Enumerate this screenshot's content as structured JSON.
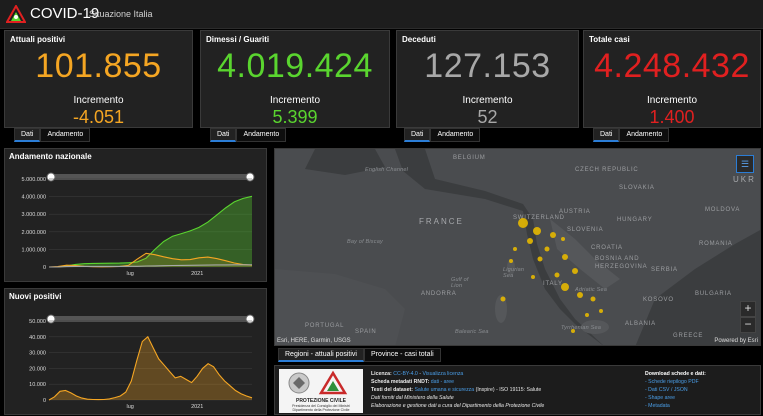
{
  "header": {
    "title": "COVID-19",
    "subtitle": "Situazione Italia"
  },
  "stats": [
    {
      "label": "Attuali positivi",
      "value": "101.855",
      "increment_label": "Incremento",
      "increment": "-4.051",
      "color": "#f5a623",
      "tabs": [
        "Dati",
        "Andamento"
      ]
    },
    {
      "label": "Dimessi / Guariti",
      "value": "4.019.424",
      "increment_label": "Incremento",
      "increment": "5.399",
      "color": "#5ad52f",
      "tabs": [
        "Dati",
        "Andamento"
      ]
    },
    {
      "label": "Deceduti",
      "value": "127.153",
      "increment_label": "Incremento",
      "increment": "52",
      "color": "#a8a8a8",
      "tabs": [
        "Dati",
        "Andamento"
      ]
    },
    {
      "label": "Totale casi",
      "value": "4.248.432",
      "increment_label": "Incremento",
      "increment": "1.400",
      "color": "#e02020",
      "tabs": [
        "Dati",
        "Andamento"
      ]
    }
  ],
  "chart_data": [
    {
      "type": "area",
      "title": "Andamento nazionale",
      "ylim": [
        0,
        5000000
      ],
      "yticks": [
        "5.000.000",
        "4.000.000",
        "3.000.000",
        "2.000.000",
        "1.000.000",
        "0"
      ],
      "xticks": [
        "lug",
        "2021"
      ],
      "series": [
        {
          "color": "#5ad52f",
          "values": [
            0,
            3000,
            60000,
            150000,
            190000,
            205000,
            210000,
            215000,
            222000,
            240000,
            290000,
            500000,
            1000000,
            1450000,
            1750000,
            1900000,
            2050000,
            2250000,
            2550000,
            2950000,
            3350000,
            3700000,
            3900000,
            4019424
          ]
        },
        {
          "color": "#f5a623",
          "values": [
            0,
            20000,
            100000,
            80000,
            40000,
            15000,
            12000,
            15000,
            35000,
            90000,
            450000,
            780000,
            700000,
            580000,
            470000,
            410000,
            420000,
            520000,
            560000,
            480000,
            360000,
            230000,
            140000,
            101855
          ]
        },
        {
          "color": "#a8a8a8",
          "values": [
            0,
            2000,
            25000,
            33000,
            34500,
            35000,
            35200,
            35500,
            35900,
            37000,
            42000,
            55000,
            65000,
            75000,
            85000,
            92000,
            97000,
            102000,
            110000,
            117000,
            122000,
            125000,
            126500,
            127153
          ]
        }
      ]
    },
    {
      "type": "area",
      "title": "Nuovi positivi",
      "ylim": [
        0,
        50000
      ],
      "yticks": [
        "50.000",
        "40.000",
        "30.000",
        "20.000",
        "10.000",
        "0"
      ],
      "xticks": [
        "lug",
        "2021"
      ],
      "series": [
        {
          "color": "#f5a623",
          "values": [
            0,
            2000,
            5500,
            6000,
            4500,
            2500,
            1200,
            500,
            300,
            250,
            300,
            700,
            1500,
            2500,
            5000,
            12000,
            25000,
            37000,
            40000,
            33000,
            26000,
            22000,
            18000,
            14000,
            15000,
            13000,
            11000,
            15000,
            20000,
            23000,
            21000,
            16000,
            12000,
            9000,
            6000,
            4000,
            2500,
            1400
          ]
        }
      ]
    }
  ],
  "map": {
    "labels": [
      {
        "text": "English Channel",
        "kind": "sea"
      },
      {
        "text": "BELGIUM",
        "kind": "small"
      },
      {
        "text": "CZECH REPUBLIC",
        "kind": "small"
      },
      {
        "text": "SLOVAKIA",
        "kind": "small"
      },
      {
        "text": "FRANCE",
        "kind": "big"
      },
      {
        "text": "AUSTRIA",
        "kind": "small"
      },
      {
        "text": "HUNGARY",
        "kind": "small"
      },
      {
        "text": "SWITZERLAND",
        "kind": "small"
      },
      {
        "text": "SLOVENIA",
        "kind": "small"
      },
      {
        "text": "CROATIA",
        "kind": "small"
      },
      {
        "text": "MOLDOVA",
        "kind": "small"
      },
      {
        "text": "ROMANIA",
        "kind": "small"
      },
      {
        "text": "Bay of Biscay",
        "kind": "sea"
      },
      {
        "text": "BOSNIA AND HERZEGOVINA",
        "kind": "small"
      },
      {
        "text": "SERBIA",
        "kind": "small"
      },
      {
        "text": "ITALY",
        "kind": "small"
      },
      {
        "text": "Ligurian Sea",
        "kind": "sea"
      },
      {
        "text": "Gulf of Lion",
        "kind": "sea"
      },
      {
        "text": "ANDORRA",
        "kind": "small"
      },
      {
        "text": "Adriatic Sea",
        "kind": "sea"
      },
      {
        "text": "BULGARIA",
        "kind": "small"
      },
      {
        "text": "KOSOVO",
        "kind": "small"
      },
      {
        "text": "PORTUGAL",
        "kind": "small"
      },
      {
        "text": "SPAIN",
        "kind": "small"
      },
      {
        "text": "ALBANIA",
        "kind": "small"
      },
      {
        "text": "Tyrrhenian Sea",
        "kind": "sea"
      },
      {
        "text": "Balearic Sea",
        "kind": "sea"
      },
      {
        "text": "GREECE",
        "kind": "small"
      },
      {
        "text": "UKR",
        "kind": "small"
      }
    ],
    "attribution_left": "Esri, HERE, Garmin, USGS",
    "attribution_right": "Powered by Esri",
    "bubble_color": "#e6b800",
    "tabs": [
      "Regioni - attuali positivi",
      "Province - casi totali"
    ]
  },
  "footer": {
    "logo_text": [
      "PROTEZIONE CIVILE",
      "Presidenza del Consiglio dei Ministri",
      "Dipartimento della Protezione Civile"
    ],
    "licenza_label": "Licenza:",
    "licenza_link": "CC-BY-4.0",
    "licenza_sep": " - ",
    "licenza_link2": "Visualizza licenza",
    "metadati_label": "Scheda metadati RNDT:",
    "metadati_link": "dati - aree",
    "testi_label": "Testi del dataset:",
    "testi_link": "Salute umana e sicurezza",
    "testi_rest": " (Inspire) - ISO 19115: Salute",
    "fonte": "Dati forniti dal Ministero della Salute",
    "elaborazione": "Elaborazione e gestione dati a cura del Dipartimento della Protezione Civile",
    "download_title": "Download schede e dati:",
    "downloads": [
      "- Schede riepilogo PDF",
      "- Dati CSV / JSON",
      "- Shape aree",
      "- Metadata"
    ]
  }
}
